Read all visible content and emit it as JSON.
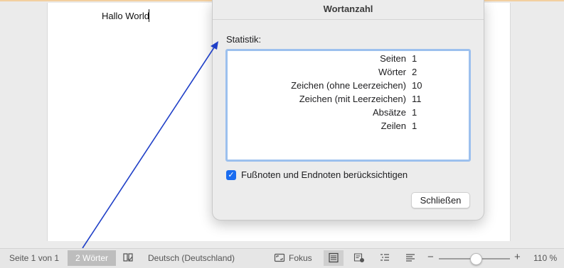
{
  "document": {
    "text": "Hallo World"
  },
  "dialog": {
    "title": "Wortanzahl",
    "stats_label": "Statistik:",
    "stats": [
      {
        "label": "Seiten",
        "value": "1"
      },
      {
        "label": "Wörter",
        "value": "2"
      },
      {
        "label": "Zeichen (ohne Leerzeichen)",
        "value": "10"
      },
      {
        "label": "Zeichen (mit Leerzeichen)",
        "value": "11"
      },
      {
        "label": "Absätze",
        "value": "1"
      },
      {
        "label": "Zeilen",
        "value": "1"
      }
    ],
    "checkbox_label": "Fußnoten und Endnoten berücksichtigen",
    "checkbox_checked": true,
    "close_label": "Schließen"
  },
  "statusbar": {
    "page": "Seite 1 von 1",
    "words": "2 Wörter",
    "language": "Deutsch (Deutschland)",
    "focus": "Fokus",
    "zoom_minus": "−",
    "zoom_plus": "+",
    "zoom": "110 %",
    "icons": [
      "spellcheck-icon",
      "focus-icon",
      "print-layout-icon",
      "track-changes-icon",
      "outline-icon",
      "web-layout-icon"
    ]
  },
  "colors": {
    "accent": "#1a6cf0",
    "annotation_arrow": "#1f3fc7",
    "word_badge": "#bdbdbd"
  }
}
